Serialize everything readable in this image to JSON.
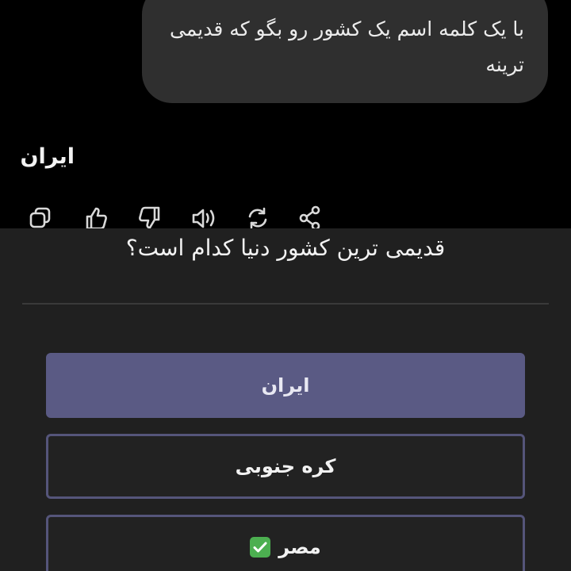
{
  "chat": {
    "user_message": "با یک کلمه اسم یک کشور رو بگو که قدیمی ترینه",
    "assistant_reply": "ایران",
    "actions": [
      {
        "name": "copy-icon"
      },
      {
        "name": "thumbs-up-icon"
      },
      {
        "name": "thumbs-down-icon"
      },
      {
        "name": "read-aloud-icon"
      },
      {
        "name": "regenerate-icon"
      },
      {
        "name": "share-icon"
      }
    ]
  },
  "quiz": {
    "question": "قدیمی ترین کشور دنیا کدام است؟",
    "options": [
      {
        "label": "ایران",
        "state": "selected"
      },
      {
        "label": "کره جنوبی",
        "state": "unselected"
      },
      {
        "label": "مصر",
        "state": "unselected",
        "badge": "check-mark-icon"
      }
    ]
  },
  "colors": {
    "selected_option": "#5a5a84",
    "option_border": "#55557a",
    "check_badge": "#4caf50",
    "bubble": "#2f2f2f"
  }
}
